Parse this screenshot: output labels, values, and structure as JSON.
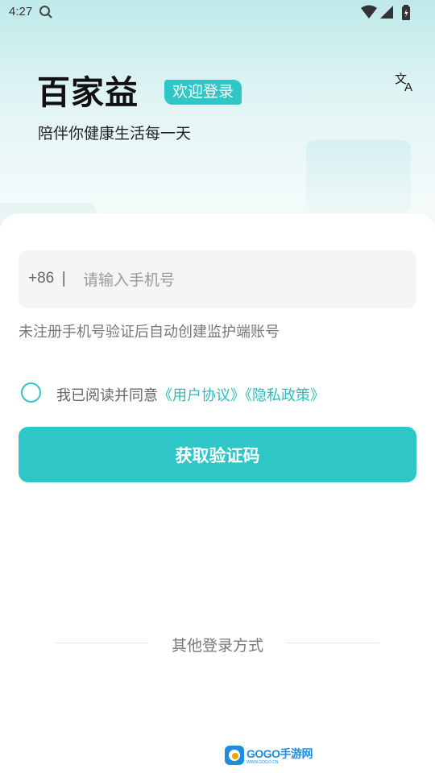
{
  "status_bar": {
    "time": "4:27"
  },
  "header": {
    "brand": "百家益",
    "welcome": "欢迎登录",
    "slogan": "陪伴你健康生活每一天"
  },
  "form": {
    "country_code": "+86",
    "country_separator": "|",
    "phone_placeholder": "请输入手机号",
    "phone_value": "",
    "hint": "未注册手机号验证后自动创建监护端账号",
    "agree_prefix": "我已阅读并同意",
    "user_agreement": "《用户协议》",
    "privacy_policy": "《隐私政策》",
    "get_code_button": "获取验证码"
  },
  "other_login": {
    "label": "其他登录方式"
  },
  "watermark": {
    "title": "GOGO手游网",
    "subtitle": "WWW.GOGO.CN"
  },
  "colors": {
    "accent": "#2ec6c6",
    "link": "#2bbdbd"
  },
  "icons": {
    "status_search": "search-icon",
    "translate": "translate-icon",
    "wifi": "wifi-icon",
    "signal": "signal-icon",
    "battery": "battery-icon"
  }
}
